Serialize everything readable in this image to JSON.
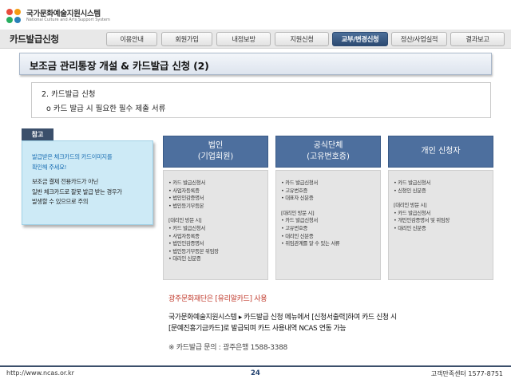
{
  "brand": {
    "name_ko": "국가문화예술지원시스템",
    "name_en": "National Culture and Arts Support System"
  },
  "header": {
    "page_title": "카드발급신청",
    "tabs": [
      {
        "label": "이용안내"
      },
      {
        "label": "회원가입"
      },
      {
        "label": "내정보방"
      },
      {
        "label": "지원신청"
      },
      {
        "label": "교부/변경신청"
      },
      {
        "label": "정산/사업실적"
      },
      {
        "label": "결과보고"
      }
    ],
    "active_tab": "교부/변경신청"
  },
  "section": {
    "title": "보조금 관리통장 개설 & 카드발급 신청 (2)",
    "sub_line1": "2. 카드발급 신청",
    "sub_line2": "ο 카드 발급 시 필요한 필수 제출 서류"
  },
  "note": {
    "tag": "참고",
    "lines": [
      "발급받은 체크카드의 카드이미지를",
      "확인해 주세요!",
      "보조금 결제 전용카드가 아닌",
      "일반 체크카드로 잘못 발급 받는 경우가",
      "발생할 수 있으므로 주의"
    ]
  },
  "columns": [
    {
      "title": "법인",
      "subtitle": "(기업회원)",
      "items": [
        "• 카드 발급신청서",
        "• 사업자등록증",
        "• 법인인감증명서",
        "• 법인등기부등본"
      ],
      "proxy_items": [
        "[대리인 방문 시]",
        "• 카드 발급신청서",
        "• 사업자등록증",
        "• 법인인감증명서",
        "• 법인등기부등본 위임장",
        "• 대리인 신분증"
      ]
    },
    {
      "title": "공식단체",
      "subtitle": "(고유번호증)",
      "items": [
        "• 카드 발급신청서",
        "• 고유번호증",
        "• 대표자 신분증"
      ],
      "proxy_items": [
        "[대리인 방문 시]",
        "• 카드 발급신청서",
        "• 고유번호증",
        "• 대리인 신분증",
        "• 위임관계를 알 수 있는 서류"
      ]
    },
    {
      "title": "개인 신청자",
      "subtitle": "",
      "items": [
        "• 카드 발급신청서",
        "• 신청인 신분증"
      ],
      "proxy_items": [
        "[대리인 방문 시]",
        "• 카드 발급신청서",
        "• 개인인감증명서 및 위임장",
        "• 대리인 신분증"
      ]
    }
  ],
  "bottom": {
    "red_note": "광주문화재단은 [유리알카드] 사용",
    "line1": "국가문화예술지원시스템 ▸ 카드발급 신청 메뉴에서 [신청서출력]하여 카드 신청 시",
    "line2": "[문예진흥기금카드]로 발급되며 카드 사용내역 NCAS 연동 가능",
    "inquiry": "※ 카드발급 문의 : 광주은행 1588-3388"
  },
  "footer": {
    "url": "http://www.ncas.or.kr",
    "page": "24",
    "phone": "고객만족센터 1577-8751"
  },
  "colors": {
    "nav_active": "#2c4a72",
    "column_header": "#4d6f9e",
    "note_bg": "#cdeaf6",
    "note_highlight": "#1b6fb3",
    "red_note": "#c0392b"
  }
}
